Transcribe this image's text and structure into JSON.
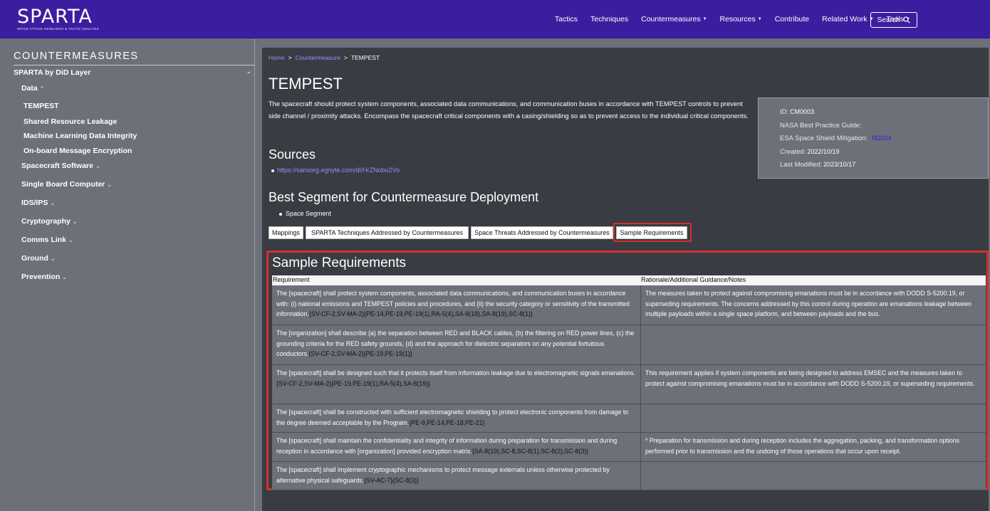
{
  "logo": {
    "text": "SPARTA",
    "subtitle": "SPACE ATTACK RESEARCH & TACTIC ANALYSIS"
  },
  "nav": {
    "items": [
      {
        "label": "Tactics",
        "dropdown": false
      },
      {
        "label": "Techniques",
        "dropdown": false
      },
      {
        "label": "Countermeasures",
        "dropdown": true
      },
      {
        "label": "Resources",
        "dropdown": true
      },
      {
        "label": "Contribute",
        "dropdown": false
      },
      {
        "label": "Related Work",
        "dropdown": true
      },
      {
        "label": "Tools",
        "dropdown": true
      }
    ],
    "search_label": "Search"
  },
  "sidebar": {
    "title": "COUNTERMEASURES",
    "layer_label": "SPARTA by DiD Layer",
    "groups": [
      {
        "label": "Data",
        "expanded": true,
        "children": [
          "TEMPEST",
          "Shared Resource Leakage",
          "Machine Learning Data Integrity",
          "On-board Message Encryption"
        ]
      },
      {
        "label": "Spacecraft Software",
        "expanded": false
      },
      {
        "label": "Single Board Computer",
        "expanded": false
      },
      {
        "label": "IDS/IPS",
        "expanded": false
      },
      {
        "label": "Cryptography",
        "expanded": false
      },
      {
        "label": "Comms Link",
        "expanded": false
      },
      {
        "label": "Ground",
        "expanded": false
      },
      {
        "label": "Prevention",
        "expanded": false
      }
    ]
  },
  "breadcrumb": {
    "home": "Home",
    "section": "Countermeasure",
    "current": "TEMPEST",
    "separator": ">"
  },
  "page": {
    "title": "TEMPEST",
    "description": "The spacecraft should protect system components, associated data communications, and communication buses in accordance with TEMPEST controls to prevent side channel / proximity attacks. Encompass the spacecraft critical components with a casing/shielding so as to prevent access to the individual critical components.",
    "sources_heading": "Sources",
    "source_link": "https://sansorg.egnyte.com/dl/HrZNobu2Vo",
    "segment_heading": "Best Segment for Countermeasure Deployment",
    "segment_item": "Space Segment"
  },
  "info": {
    "id_label": "ID:",
    "id_value": "CM0003",
    "nasa_label": "NASA Best Practice Guide:",
    "esa_label": "ESA Space Shield Mitigation:",
    "esa_value": "M2034",
    "created_label": "Created:",
    "created_value": "2022/10/19",
    "modified_label": "Last Modified:",
    "modified_value": "2023/10/17"
  },
  "tabs": [
    "Mappings",
    "SPARTA Techniques Addressed by Countermeasures",
    "Space Threats Addressed by Countermeasures",
    "Sample Requirements"
  ],
  "requirements": {
    "heading": "Sample Requirements",
    "col1": "Requirement",
    "col2": "Rationale/Additional Guidance/Notes",
    "rows": [
      {
        "req": "The [spacecraft] shall protect system components, associated data communications, and communication buses in accordance with: (i) national emissions and TEMPEST policies and procedures, and (ii) the security category or sensitivity of the transmitted information.",
        "ctrl": "{SV-CF-2,SV-MA-2}{PE-14,PE-19,PE-19(1),RA-5(4),SA-8(18),SA-8(19),SC-8(1)}",
        "note": "The measures taken to protect against compromising emanations must be in accordance with DODD S-5200.19, or superseding requirements. The concerns addressed by this control during operation are emanations leakage between multiple payloads within a single space platform, and between payloads and the bus."
      },
      {
        "req": "The [organization] shall describe (a) the separation between RED and BLACK cables, (b) the filtering on RED power lines, (c) the grounding criteria for the RED safety grounds, (d) and the approach for dielectric separators on any potential fortuitous conductors.",
        "ctrl": "{SV-CF-2,SV-MA-2}{PE-19,PE-19(1)}",
        "note": ""
      },
      {
        "req": "The [spacecraft] shall be designed such that it protects itself from information leakage due to electromagnetic signals emanations.",
        "ctrl": "{SV-CF-2,SV-MA-2}{PE-19,PE-19(1),RA-5(4),SA-8(19)}",
        "note": "This requirement applies if system components are being designed to address EMSEC and the measures taken to protect against compromising emanations must be in accordance with DODD S-5200.19, or superseding requirements."
      },
      {
        "req": "The [spacecraft] shall be constructed with sufficient electromagnetic shielding to protect electronic components from damage to the degree deemed acceptable by the Program.",
        "ctrl": "{PE-9,PE-14,PE-18,PE-21}",
        "note": ""
      },
      {
        "req": "The [spacecraft] shall maintain the confidentiality and integrity of information during preparation for transmission and during reception in accordance with [organization] provided encryption matrix.",
        "ctrl": "{SA-8(19),SC-8,SC-8(1),SC-8(2),SC-8(3)}",
        "note": "* Preparation for transmission and during reception includes the aggregation, packing, and transformation options performed prior to transmission and the undoing of those operations that occur upon receipt."
      },
      {
        "req": "The [spacecraft] shall implement cryptographic mechanisms to protect message externals unless otherwise protected by alternative physical safeguards.",
        "ctrl": "{SV-AC-7}{SC-8(3)}",
        "note": ""
      }
    ]
  }
}
